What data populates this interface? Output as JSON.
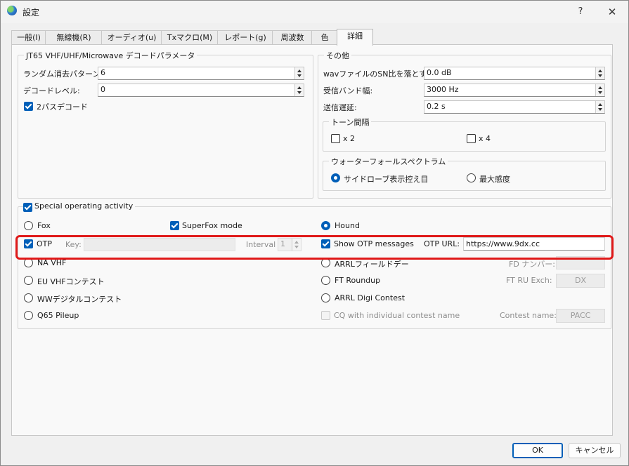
{
  "window": {
    "title": "設定",
    "help": "?",
    "close": "✕"
  },
  "tabs": [
    "一般(I)",
    "無線機(R)",
    "オーディオ(u)",
    "Txマクロ(M)",
    "レポート(g)",
    "周波数",
    "色",
    "詳細"
  ],
  "decode_group": {
    "title": "JT65 VHF/UHF/Microwave デコードパラメータ",
    "random_erasure_label": "ランダム消去パターン:",
    "random_erasure_value": "6",
    "decode_level_label": "デコードレベル:",
    "decode_level_value": "0",
    "two_pass_label": "2パスデコード",
    "two_pass_checked": true
  },
  "misc_group": {
    "title": "その他",
    "wav_snr_label": "wavファイルのSN比を落とす:",
    "wav_snr_value": "0.0 dB",
    "rx_bandwidth_label": "受信バンド幅:",
    "rx_bandwidth_value": "3000  Hz",
    "tx_delay_label": "送信遅延:",
    "tx_delay_value": "0.2  s",
    "tone_spacing": {
      "title": "トーン間隔",
      "x2_label": "x 2",
      "x4_label": "x 4"
    },
    "waterfall": {
      "title": "ウォーターフォールスペクトラム",
      "sidelobe_label": "サイドローブ表示控え目",
      "max_sensitivity_label": "最大感度"
    }
  },
  "special": {
    "title": "Special operating activity",
    "checked": true,
    "fox_label": "Fox",
    "superfox_label": "SuperFox mode",
    "hound_label": "Hound",
    "otp_label": "OTP",
    "key_label": "Key:",
    "key_value": "",
    "interval_label": "Interval",
    "interval_value": "1",
    "show_otp_label": "Show OTP messages",
    "otp_url_label": "OTP URL:",
    "otp_url_value": "https://www.9dx.cc",
    "na_vhf_label": "NA VHF",
    "arrl_fd_label": "ARRLフィールドデー",
    "fd_number_label": "FD ナンバー:",
    "fd_number_value": "",
    "eu_vhf_label": "EU VHFコンテスト",
    "ft_roundup_label": "FT Roundup",
    "ft_ru_exch_label": "FT RU Exch:",
    "ft_ru_exch_value": "DX",
    "ww_digi_label": "WWデジタルコンテスト",
    "arrl_digi_label": "ARRL Digi Contest",
    "q65_label": "Q65 Pileup",
    "cq_individual_label": "CQ with individual contest name",
    "contest_name_label": "Contest name:",
    "contest_name_value": "PACC"
  },
  "buttons": {
    "ok": "OK",
    "cancel": "キャンセル"
  },
  "colors": {
    "accent": "#005fb8",
    "highlight": "#e01919"
  }
}
